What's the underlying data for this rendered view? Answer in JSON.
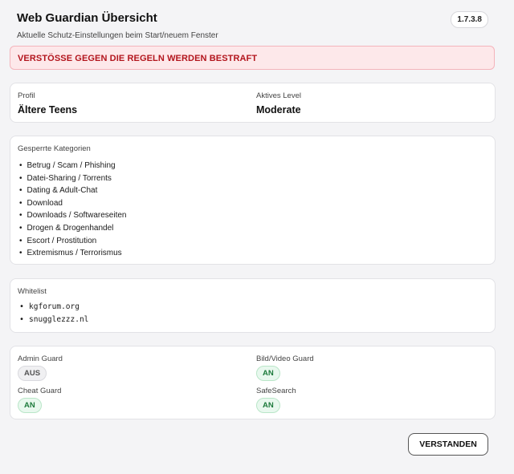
{
  "header": {
    "title": "Web Guardian Übersicht",
    "subtitle": "Aktuelle Schutz-Einstellungen beim Start/neuem Fenster",
    "version": "1.7.3.8"
  },
  "alert": {
    "text": "VERSTÖSSE GEGEN DIE REGELN WERDEN BESTRAFT",
    "color": "#b3151d"
  },
  "profile": {
    "profile_label": "Profil",
    "profile_value": "Ältere Teens",
    "level_label": "Aktives Level",
    "level_value": "Moderate"
  },
  "categories": {
    "title": "Gesperrte Kategorien",
    "items": [
      "Betrug / Scam / Phishing",
      "Datei-Sharing / Torrents",
      "Dating & Adult-Chat",
      "Download",
      "Downloads / Softwareseiten",
      "Drogen & Drogenhandel",
      "Escort / Prostitution",
      "Extremismus / Terrorismus"
    ]
  },
  "whitelist": {
    "title": "Whitelist",
    "items": [
      "kgforum.org",
      "snugglezzz.nl"
    ]
  },
  "guards": {
    "admin": {
      "label": "Admin Guard",
      "status": "AUS"
    },
    "bild": {
      "label": "Bild/Video Guard",
      "status": "AN"
    },
    "cheat": {
      "label": "Cheat Guard",
      "status": "AN"
    },
    "safesearch": {
      "label": "SafeSearch",
      "status": "AN"
    }
  },
  "actions": {
    "confirm_label": "VERSTANDEN"
  }
}
